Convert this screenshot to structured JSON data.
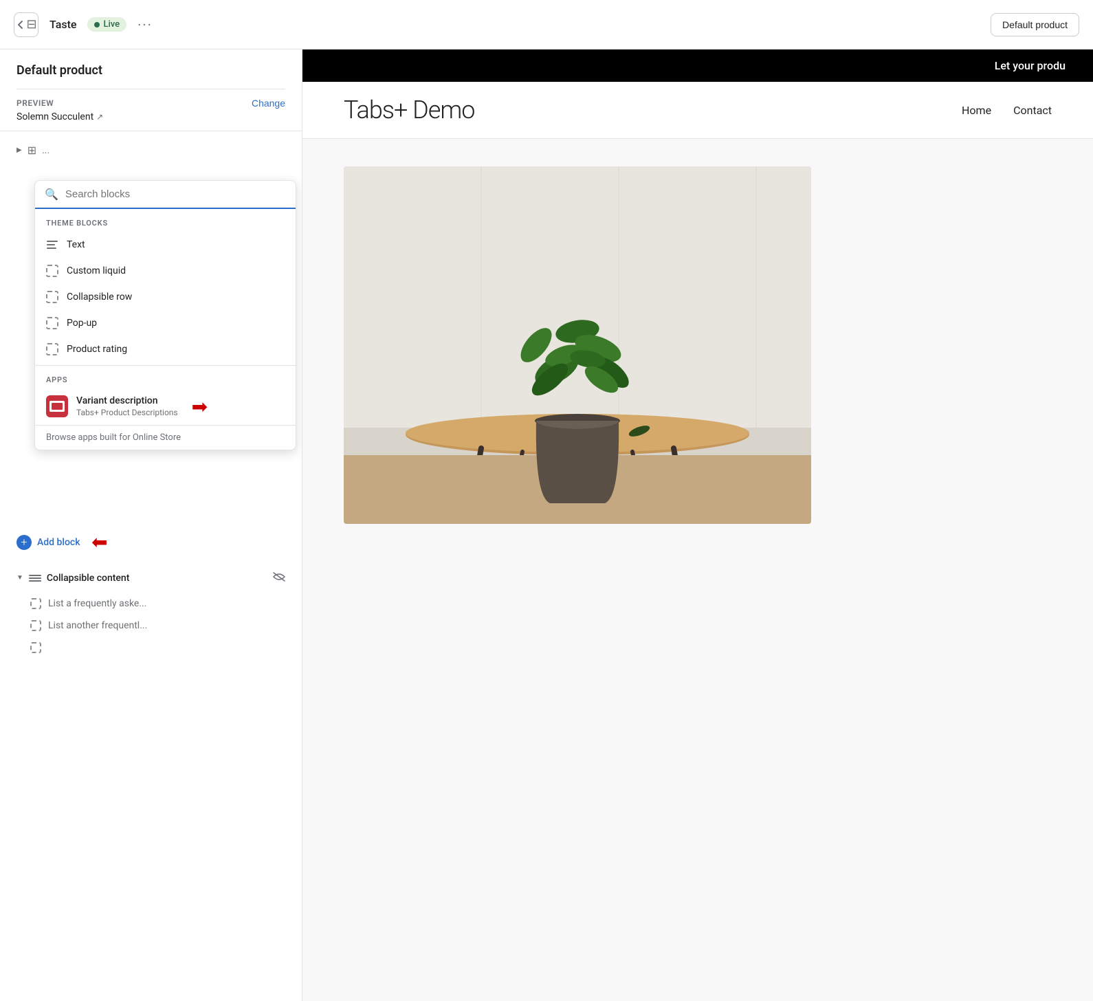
{
  "topbar": {
    "back_icon": "←",
    "site_name": "Taste",
    "live_label": "Live",
    "dots_label": "···",
    "right_button": "Default product"
  },
  "sidebar": {
    "title": "Default product",
    "preview_label": "PREVIEW",
    "change_label": "Change",
    "product_name": "Solemn Succulent",
    "search": {
      "placeholder": "Search blocks"
    },
    "theme_blocks_label": "THEME BLOCKS",
    "theme_blocks": [
      {
        "label": "Text",
        "icon": "lines"
      },
      {
        "label": "Custom liquid",
        "icon": "dashed"
      },
      {
        "label": "Collapsible row",
        "icon": "dashed"
      },
      {
        "label": "Pop-up",
        "icon": "dashed"
      },
      {
        "label": "Product rating",
        "icon": "dashed"
      }
    ],
    "apps_label": "APPS",
    "app_block": {
      "name": "Variant description",
      "subtitle": "Tabs+ Product Descriptions"
    },
    "browse_apps": "Browse apps built for Online Store",
    "add_block_label": "Add block",
    "collapsible_content_label": "Collapsible content",
    "sub_items": [
      "List a frequently aske...",
      "List another frequentl..."
    ]
  },
  "preview": {
    "topbar_text": "Let your produ",
    "logo": "Tabs+ Demo",
    "nav_links": [
      "Home",
      "Contact"
    ]
  }
}
